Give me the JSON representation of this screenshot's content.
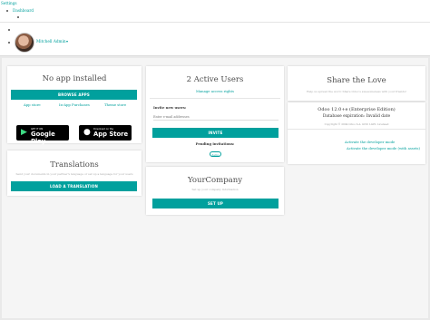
{
  "nav": {
    "settings_label": "Settings",
    "dashboard_label": "Dashboard",
    "user_name": "Mitchell Admin",
    "caret": "▾"
  },
  "apps_card": {
    "title": "No app installed",
    "browse_button": "BROWSE APPS",
    "links": [
      "App store",
      "In-App Purchases",
      "Theme store"
    ]
  },
  "stores": {
    "google": {
      "small": "GET IT ON",
      "big": "Google Play"
    },
    "apple": {
      "small": "Download on the",
      "big": "App Store"
    }
  },
  "translations_card": {
    "title": "Translations",
    "subtitle": "Send your documents in your partner's language or set up a language for your users",
    "button": "LOAD A TRANSLATION"
  },
  "users_card": {
    "title": "2 Active Users",
    "manage_link": "Manage access rights",
    "invite_label": "Invite new users:",
    "email_placeholder": "Enter e-mail addresses",
    "invite_button": "INVITE",
    "pending_label": "Pending invitations:",
    "pending_badge": "demo"
  },
  "company_card": {
    "title": "YourCompany",
    "subtitle": "Set up your company information",
    "button": "SET UP"
  },
  "share_card": {
    "title": "Share the Love",
    "subtitle": "Help us spread the word: Share Odoo's awesomeness with your friends!"
  },
  "version_card": {
    "version": "Odoo 12.0+e (Enterprise Edition)",
    "expiration": "Database expiration: Invalid date",
    "copyright": "Copyright © 2004 Odoo S.A. GNU LGPL Licensed",
    "dev_mode": "Activate the developer mode",
    "dev_mode_assets": "Activate the developer mode (with assets)"
  },
  "colors": {
    "accent": "#00a09d",
    "background": "#e9e9e9"
  }
}
